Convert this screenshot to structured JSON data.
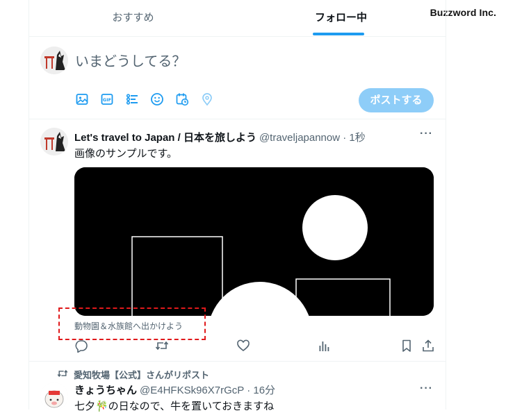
{
  "watermark": "Buzzword Inc.",
  "tabs": [
    {
      "label": "おすすめ",
      "active": false
    },
    {
      "label": "フォロー中",
      "active": true
    }
  ],
  "composer": {
    "placeholder": "いまどうしてる？",
    "icons": [
      "image-icon",
      "gif-icon",
      "poll-icon",
      "emoji-icon",
      "schedule-icon",
      "location-icon"
    ],
    "post_label": "ポストする"
  },
  "tweet": {
    "name": "Let's travel to Japan / 日本を旅しよう",
    "meta": "@traveljapannow · 1秒",
    "more": "···",
    "text": "画像のサンプルです。",
    "caption": "動物園＆水族館へ出かけよう",
    "actions": [
      "reply-icon",
      "repost-icon",
      "like-icon",
      "views-icon",
      "bookmark-icon",
      "share-icon"
    ]
  },
  "repost": {
    "reposted_by": "愛知牧場【公式】さんがリポスト",
    "name": "きょうちゃん",
    "meta": "@E4HFKSk96X7rGcP · 16分",
    "more": "···",
    "text": "七夕🎋の日なので、牛を置いておきますね"
  },
  "colors": {
    "accent": "#1d9bf0",
    "post_button_disabled": "#8ecdf8",
    "secondary_text": "#536471",
    "caption_box": "#e0191b"
  }
}
